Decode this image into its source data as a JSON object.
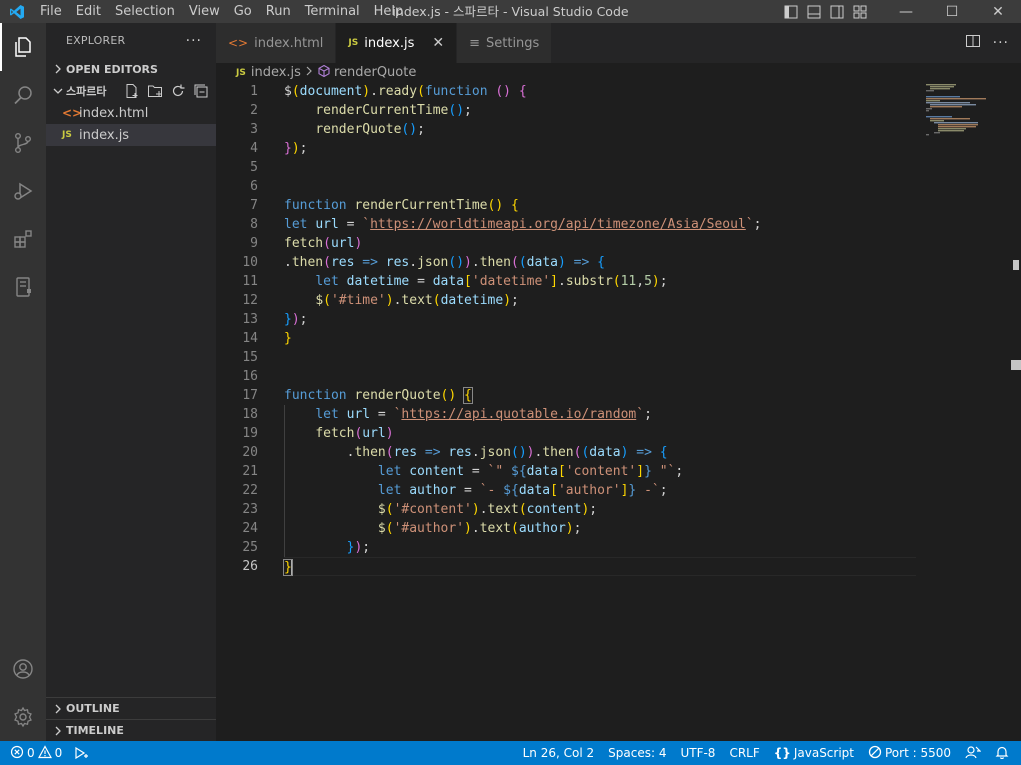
{
  "window": {
    "title": "index.js - 스파르타 - Visual Studio Code",
    "menu": [
      "File",
      "Edit",
      "Selection",
      "View",
      "Go",
      "Run",
      "Terminal",
      "Help"
    ],
    "controls": {
      "minimize": "—",
      "maximize": "☐",
      "close": "✕"
    }
  },
  "sidebar": {
    "header": "EXPLORER",
    "more": "···",
    "open_editors": "OPEN EDITORS",
    "folder": "스파르타",
    "files": [
      {
        "name": "index.html",
        "type": "html",
        "icon": "<>"
      },
      {
        "name": "index.js",
        "type": "js",
        "icon": "JS"
      }
    ],
    "outline": "OUTLINE",
    "timeline": "TIMELINE"
  },
  "tabs": [
    {
      "label": "index.html",
      "icon": "<>"
    },
    {
      "label": "index.js",
      "icon": "JS"
    },
    {
      "label": "Settings",
      "icon": "≡"
    }
  ],
  "breadcrumb": {
    "file_icon": "JS",
    "file": "index.js",
    "symbol": "renderQuote"
  },
  "editor": {
    "current_line": 26,
    "line_numbers": [
      "1",
      "2",
      "3",
      "4",
      "5",
      "6",
      "7",
      "8",
      "9",
      "10",
      "11",
      "12",
      "13",
      "14",
      "15",
      "16",
      "17",
      "18",
      "19",
      "20",
      "21",
      "22",
      "23",
      "24",
      "25",
      "26"
    ],
    "lines": [
      [
        [
          "tk-def",
          "$"
        ],
        [
          "tk-p1",
          "("
        ],
        [
          "tk-var",
          "document"
        ],
        [
          "tk-p1",
          ")"
        ],
        [
          "tk-def",
          "."
        ],
        [
          "tk-fn",
          "ready"
        ],
        [
          "tk-p1",
          "("
        ],
        [
          "tk-kw",
          "function"
        ],
        [
          "tk-def",
          " "
        ],
        [
          "tk-p2",
          "()"
        ],
        [
          "tk-def",
          " "
        ],
        [
          "tk-p2",
          "{"
        ]
      ],
      [
        [
          "tk-def",
          "    "
        ],
        [
          "tk-fn",
          "renderCurrentTime"
        ],
        [
          "tk-p3",
          "()"
        ],
        [
          "tk-def",
          ";"
        ]
      ],
      [
        [
          "tk-def",
          "    "
        ],
        [
          "tk-fn",
          "renderQuote"
        ],
        [
          "tk-p3",
          "()"
        ],
        [
          "tk-def",
          ";"
        ]
      ],
      [
        [
          "tk-p2",
          "}"
        ],
        [
          "tk-p1",
          ")"
        ],
        [
          "tk-def",
          ";"
        ]
      ],
      [],
      [],
      [
        [
          "tk-kw",
          "function"
        ],
        [
          "tk-def",
          " "
        ],
        [
          "tk-fn",
          "renderCurrentTime"
        ],
        [
          "tk-p1",
          "()"
        ],
        [
          "tk-def",
          " "
        ],
        [
          "tk-p1",
          "{"
        ]
      ],
      [
        [
          "tk-kw",
          "let"
        ],
        [
          "tk-def",
          " "
        ],
        [
          "tk-var",
          "url"
        ],
        [
          "tk-def",
          " = "
        ],
        [
          "tk-str",
          "`"
        ],
        [
          "tk-url",
          "https://worldtimeapi.org/api/timezone/Asia/Seoul"
        ],
        [
          "tk-str",
          "`"
        ],
        [
          "tk-def",
          ";"
        ]
      ],
      [
        [
          "tk-fn",
          "fetch"
        ],
        [
          "tk-p2",
          "("
        ],
        [
          "tk-var",
          "url"
        ],
        [
          "tk-p2",
          ")"
        ]
      ],
      [
        [
          "tk-def",
          "."
        ],
        [
          "tk-fn",
          "then"
        ],
        [
          "tk-p2",
          "("
        ],
        [
          "tk-var",
          "res"
        ],
        [
          "tk-def",
          " "
        ],
        [
          "tk-kw",
          "=>"
        ],
        [
          "tk-def",
          " "
        ],
        [
          "tk-var",
          "res"
        ],
        [
          "tk-def",
          "."
        ],
        [
          "tk-fn",
          "json"
        ],
        [
          "tk-p3",
          "()"
        ],
        [
          "tk-p2",
          ")"
        ],
        [
          "tk-def",
          "."
        ],
        [
          "tk-fn",
          "then"
        ],
        [
          "tk-p2",
          "("
        ],
        [
          "tk-p3",
          "("
        ],
        [
          "tk-var",
          "data"
        ],
        [
          "tk-p3",
          ")"
        ],
        [
          "tk-def",
          " "
        ],
        [
          "tk-kw",
          "=>"
        ],
        [
          "tk-def",
          " "
        ],
        [
          "tk-p3",
          "{"
        ]
      ],
      [
        [
          "tk-def",
          "    "
        ],
        [
          "tk-kw",
          "let"
        ],
        [
          "tk-def",
          " "
        ],
        [
          "tk-var",
          "datetime"
        ],
        [
          "tk-def",
          " = "
        ],
        [
          "tk-var",
          "data"
        ],
        [
          "tk-p1",
          "["
        ],
        [
          "tk-str",
          "'datetime'"
        ],
        [
          "tk-p1",
          "]"
        ],
        [
          "tk-def",
          "."
        ],
        [
          "tk-fn",
          "substr"
        ],
        [
          "tk-p1",
          "("
        ],
        [
          "tk-num",
          "11"
        ],
        [
          "tk-def",
          ","
        ],
        [
          "tk-num",
          "5"
        ],
        [
          "tk-p1",
          ")"
        ],
        [
          "tk-def",
          ";"
        ]
      ],
      [
        [
          "tk-def",
          "    "
        ],
        [
          "tk-fn",
          "$"
        ],
        [
          "tk-p1",
          "("
        ],
        [
          "tk-str",
          "'#time'"
        ],
        [
          "tk-p1",
          ")"
        ],
        [
          "tk-def",
          "."
        ],
        [
          "tk-fn",
          "text"
        ],
        [
          "tk-p1",
          "("
        ],
        [
          "tk-var",
          "datetime"
        ],
        [
          "tk-p1",
          ")"
        ],
        [
          "tk-def",
          ";"
        ]
      ],
      [
        [
          "tk-p3",
          "}"
        ],
        [
          "tk-p2",
          ")"
        ],
        [
          "tk-def",
          ";"
        ]
      ],
      [
        [
          "tk-p1",
          "}"
        ]
      ],
      [],
      [],
      [
        [
          "tk-kw",
          "function"
        ],
        [
          "tk-def",
          " "
        ],
        [
          "tk-fn",
          "renderQuote"
        ],
        [
          "tk-p1",
          "()"
        ],
        [
          "tk-def",
          " "
        ],
        [
          "tk-p1 bracket-box",
          "{"
        ]
      ],
      [
        [
          "tk-def",
          "    "
        ],
        [
          "tk-kw",
          "let"
        ],
        [
          "tk-def",
          " "
        ],
        [
          "tk-var",
          "url"
        ],
        [
          "tk-def",
          " = "
        ],
        [
          "tk-str",
          "`"
        ],
        [
          "tk-url",
          "https://api.quotable.io/random"
        ],
        [
          "tk-str",
          "`"
        ],
        [
          "tk-def",
          ";"
        ]
      ],
      [
        [
          "tk-def",
          "    "
        ],
        [
          "tk-fn",
          "fetch"
        ],
        [
          "tk-p2",
          "("
        ],
        [
          "tk-var",
          "url"
        ],
        [
          "tk-p2",
          ")"
        ]
      ],
      [
        [
          "tk-def",
          "        ."
        ],
        [
          "tk-fn",
          "then"
        ],
        [
          "tk-p2",
          "("
        ],
        [
          "tk-var",
          "res"
        ],
        [
          "tk-def",
          " "
        ],
        [
          "tk-kw",
          "=>"
        ],
        [
          "tk-def",
          " "
        ],
        [
          "tk-var",
          "res"
        ],
        [
          "tk-def",
          "."
        ],
        [
          "tk-fn",
          "json"
        ],
        [
          "tk-p3",
          "()"
        ],
        [
          "tk-p2",
          ")"
        ],
        [
          "tk-def",
          "."
        ],
        [
          "tk-fn",
          "then"
        ],
        [
          "tk-p2",
          "("
        ],
        [
          "tk-p3",
          "("
        ],
        [
          "tk-var",
          "data"
        ],
        [
          "tk-p3",
          ")"
        ],
        [
          "tk-def",
          " "
        ],
        [
          "tk-kw",
          "=>"
        ],
        [
          "tk-def",
          " "
        ],
        [
          "tk-p3",
          "{"
        ]
      ],
      [
        [
          "tk-def",
          "            "
        ],
        [
          "tk-kw",
          "let"
        ],
        [
          "tk-def",
          " "
        ],
        [
          "tk-var",
          "content"
        ],
        [
          "tk-def",
          " = "
        ],
        [
          "tk-str",
          "`\" "
        ],
        [
          "tk-tpl",
          "${"
        ],
        [
          "tk-var",
          "data"
        ],
        [
          "tk-p1",
          "["
        ],
        [
          "tk-str",
          "'content'"
        ],
        [
          "tk-p1",
          "]"
        ],
        [
          "tk-tpl",
          "}"
        ],
        [
          "tk-str",
          " \"`"
        ],
        [
          "tk-def",
          ";"
        ]
      ],
      [
        [
          "tk-def",
          "            "
        ],
        [
          "tk-kw",
          "let"
        ],
        [
          "tk-def",
          " "
        ],
        [
          "tk-var",
          "author"
        ],
        [
          "tk-def",
          " = "
        ],
        [
          "tk-str",
          "`- "
        ],
        [
          "tk-tpl",
          "${"
        ],
        [
          "tk-var",
          "data"
        ],
        [
          "tk-p1",
          "["
        ],
        [
          "tk-str",
          "'author'"
        ],
        [
          "tk-p1",
          "]"
        ],
        [
          "tk-tpl",
          "}"
        ],
        [
          "tk-str",
          " -`"
        ],
        [
          "tk-def",
          ";"
        ]
      ],
      [
        [
          "tk-def",
          "            "
        ],
        [
          "tk-fn",
          "$"
        ],
        [
          "tk-p1",
          "("
        ],
        [
          "tk-str",
          "'#content'"
        ],
        [
          "tk-p1",
          ")"
        ],
        [
          "tk-def",
          "."
        ],
        [
          "tk-fn",
          "text"
        ],
        [
          "tk-p1",
          "("
        ],
        [
          "tk-var",
          "content"
        ],
        [
          "tk-p1",
          ")"
        ],
        [
          "tk-def",
          ";"
        ]
      ],
      [
        [
          "tk-def",
          "            "
        ],
        [
          "tk-fn",
          "$"
        ],
        [
          "tk-p1",
          "("
        ],
        [
          "tk-str",
          "'#author'"
        ],
        [
          "tk-p1",
          ")"
        ],
        [
          "tk-def",
          "."
        ],
        [
          "tk-fn",
          "text"
        ],
        [
          "tk-p1",
          "("
        ],
        [
          "tk-var",
          "author"
        ],
        [
          "tk-p1",
          ")"
        ],
        [
          "tk-def",
          ";"
        ]
      ],
      [
        [
          "tk-def",
          "        "
        ],
        [
          "tk-p3",
          "}"
        ],
        [
          "tk-p2",
          ")"
        ],
        [
          "tk-def",
          ";"
        ]
      ],
      [
        [
          "tk-p1 bracket-box",
          "}"
        ]
      ]
    ]
  },
  "statusbar": {
    "errors": "0",
    "warnings": "0",
    "position": "Ln 26, Col 2",
    "spaces": "Spaces: 4",
    "encoding": "UTF-8",
    "eol": "CRLF",
    "language": "JavaScript",
    "port": "Port : 5500"
  },
  "colors": {
    "accent": "#007acc",
    "titlebar": "#3c3c3c",
    "activitybar": "#333333",
    "sidebar": "#252526",
    "editor": "#1e1e1e"
  }
}
